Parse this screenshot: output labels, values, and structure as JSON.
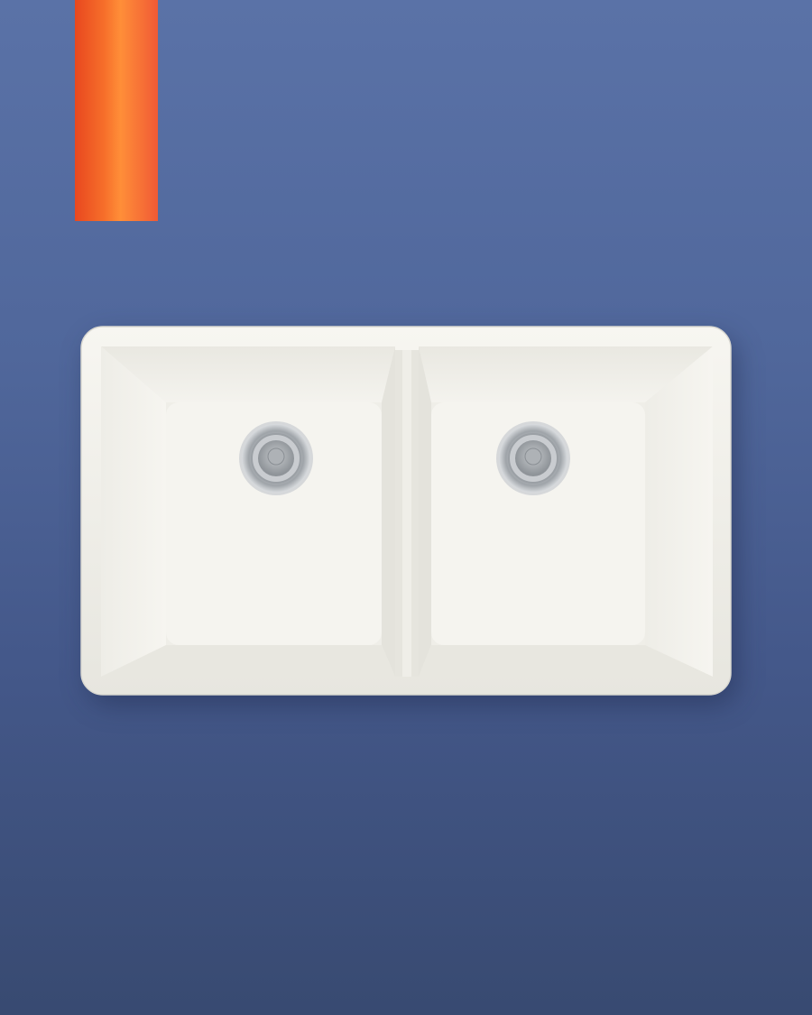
{
  "scene": {
    "background_colors": [
      "#5a72a7",
      "#384a71"
    ],
    "accent_bar_colors": [
      "#e8481f",
      "#ff8e38",
      "#f05a35"
    ],
    "product": "double-bowl-undermount-sink",
    "sink_color": "#f3f2ec",
    "drain_color": "#b9bcbf"
  }
}
